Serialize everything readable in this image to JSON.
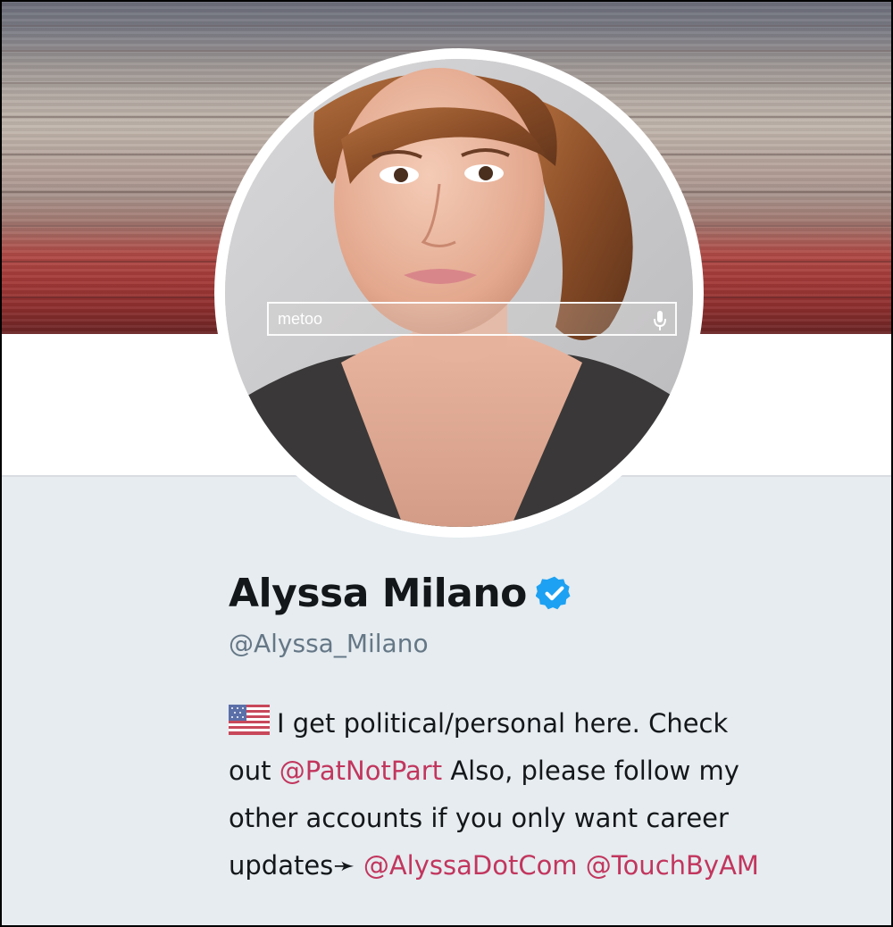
{
  "profile": {
    "name": "Alyssa Milano",
    "handle": "@Alyssa_Milano",
    "verified": true,
    "avatar_search_text": "metoo",
    "bio": {
      "flag_icon": "us-flag-icon",
      "line1_text": "I get political/personal here. Check",
      "line2_prefix": "out ",
      "line2_mention": "@PatNotPart",
      "line2_suffix": " Also, please follow my",
      "line3_text": "other accounts if you only want career",
      "line4_prefix": "updates",
      "arrow": "➛",
      "mention_1": "@AlyssaDotCom",
      "mention_2": "@TouchByAM"
    }
  },
  "colors": {
    "mention": "#c2365e",
    "verified_badge": "#1da1f2",
    "profile_background": "#e6ecf0",
    "handle_text": "#657786"
  }
}
